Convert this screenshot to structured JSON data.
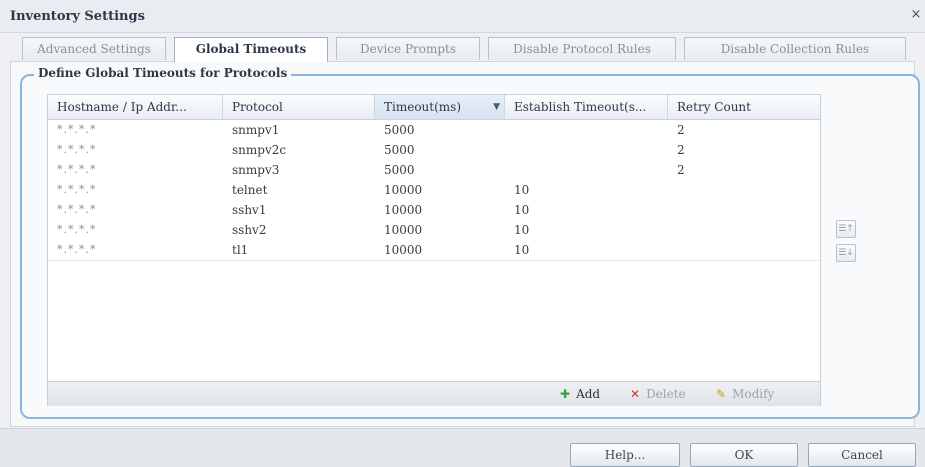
{
  "window": {
    "title": "Inventory Settings",
    "close_symbol": "×"
  },
  "tabs": [
    {
      "label": "Advanced Settings",
      "active": false
    },
    {
      "label": "Global Timeouts",
      "active": true
    },
    {
      "label": "Device Prompts",
      "active": false
    },
    {
      "label": "Disable Protocol Rules",
      "active": false
    },
    {
      "label": "Disable Collection Rules",
      "active": false
    }
  ],
  "section": {
    "legend": "Define Global Timeouts for Protocols"
  },
  "table": {
    "columns": [
      "Hostname / Ip Addr...",
      "Protocol",
      "Timeout(ms)",
      "Establish Timeout(s...",
      "Retry Count"
    ],
    "sorted_column": "Timeout(ms)",
    "sort_symbol": "▼",
    "rows": [
      {
        "hostname": "*.*.*.*",
        "protocol": "snmpv1",
        "timeout": "5000",
        "establish": "",
        "retry": "2"
      },
      {
        "hostname": "*.*.*.*",
        "protocol": "snmpv2c",
        "timeout": "5000",
        "establish": "",
        "retry": "2"
      },
      {
        "hostname": "*.*.*.*",
        "protocol": "snmpv3",
        "timeout": "5000",
        "establish": "",
        "retry": "2"
      },
      {
        "hostname": "*.*.*.*",
        "protocol": "telnet",
        "timeout": "10000",
        "establish": "10",
        "retry": ""
      },
      {
        "hostname": "*.*.*.*",
        "protocol": "sshv1",
        "timeout": "10000",
        "establish": "10",
        "retry": ""
      },
      {
        "hostname": "*.*.*.*",
        "protocol": "sshv2",
        "timeout": "10000",
        "establish": "10",
        "retry": ""
      },
      {
        "hostname": "*.*.*.*",
        "protocol": "tl1",
        "timeout": "10000",
        "establish": "10",
        "retry": ""
      }
    ]
  },
  "toolbar": {
    "add_label": "Add",
    "add_icon": "✚",
    "delete_label": "Delete",
    "delete_icon": "✕",
    "modify_label": "Modify",
    "modify_icon": "✎"
  },
  "side_buttons": {
    "move_up_icon": "☰↑",
    "move_down_icon": "☰↓"
  },
  "buttons": {
    "help": "Help...",
    "ok": "OK",
    "cancel": "Cancel"
  },
  "colors": {
    "add_icon": "#3aa34a",
    "delete_icon": "#d13a2c",
    "modify_icon": "#c89a1e",
    "fieldset_border": "#8db4dc"
  }
}
